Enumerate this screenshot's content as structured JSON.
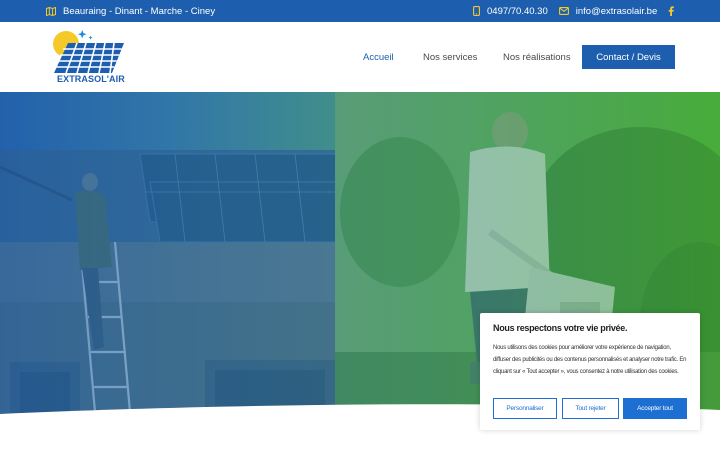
{
  "topbar": {
    "locations": "Beauraing - Dinant - Marche - Ciney",
    "phone": "0497/70.40.30",
    "email": "info@extrasolair.be",
    "icons": [
      "map-icon",
      "phone-icon",
      "mail-icon",
      "facebook-icon"
    ]
  },
  "header": {
    "logo_text": "EXTRASOL'AIR",
    "nav": [
      {
        "label": "Accueil",
        "active": true
      },
      {
        "label": "Nos services",
        "active": false
      },
      {
        "label": "Nos réalisations",
        "active": false
      }
    ],
    "cta_label": "Contact / Devis"
  },
  "cookie_banner": {
    "title": "Nous respectons votre vie privée.",
    "text": "Nous utilisons des cookies pour améliorer votre expérience de navigation, diffuser des publicités ou des contenus personnalisés et analyser notre trafic. En cliquant sur « Tout accepter », vous consentez à notre utilisation des cookies.",
    "buttons": {
      "customize": "Personnaliser",
      "reject": "Tout rejeter",
      "accept": "Accepter tout"
    }
  },
  "colors": {
    "brand_blue": "#1d5fae",
    "cookie_blue": "#1d6fd1",
    "hero_green": "#4fae3a",
    "logo_yellow": "#f5c92a"
  }
}
